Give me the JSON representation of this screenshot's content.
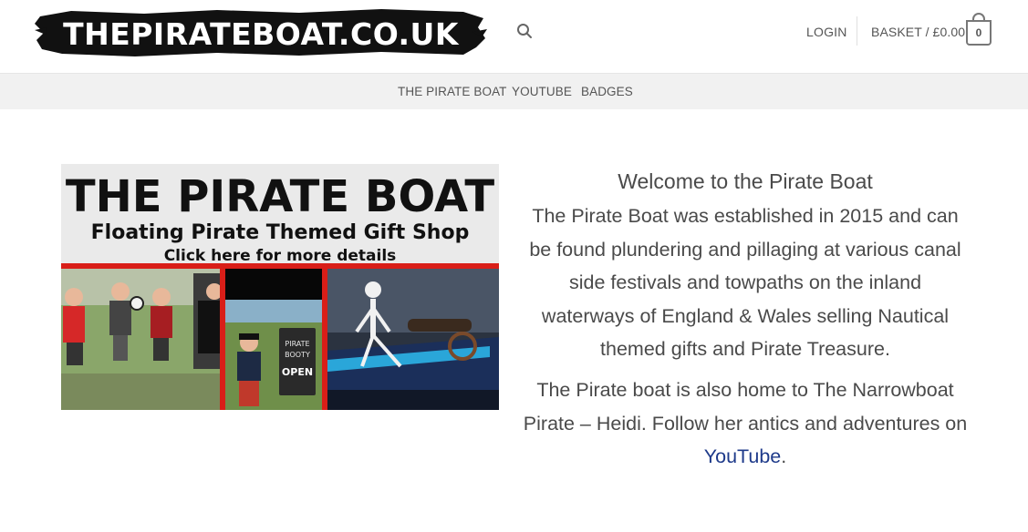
{
  "header": {
    "logo_text": "THEPIRATEBOAT.CO.UK",
    "login_label": "LOGIN",
    "basket_label": "BASKET / £0.00",
    "basket_count": "0",
    "colors": {
      "logo_bg": "#111111",
      "logo_text": "#ffffff"
    }
  },
  "nav": {
    "items": [
      {
        "label": "THE PIRATE BOAT"
      },
      {
        "label": "YOUTUBE"
      },
      {
        "label": "BADGES"
      }
    ]
  },
  "banner": {
    "title": "THE PIRATE BOAT",
    "subtitle": "Floating Pirate Themed Gift Shop",
    "cta": "Click here for more details",
    "sign_line1": "PIRATE",
    "sign_line2": "BOOTY",
    "sign_open": "OPEN"
  },
  "main": {
    "heading": "Welcome to the Pirate Boat",
    "paragraph1": "The Pirate Boat was established in 2015 and can be found plundering and pillaging at various canal side festivals and towpaths on the inland waterways of England & Wales selling Nautical themed gifts and Pirate Treasure.",
    "paragraph2_before": "The Pirate boat is also home to The Narrowboat Pirate – Heidi.  Follow her antics and adventures on ",
    "paragraph2_link": "YouTube",
    "paragraph2_after": "."
  }
}
